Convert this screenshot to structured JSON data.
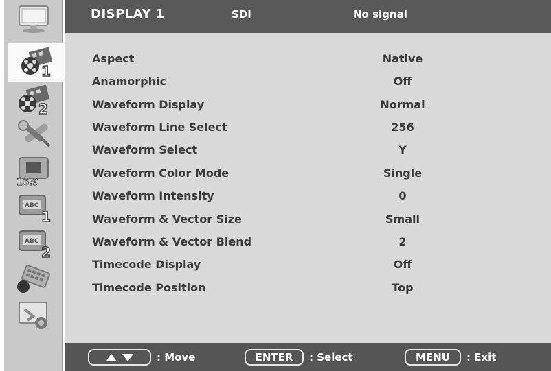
{
  "header": {
    "title": "DISPLAY 1",
    "input": "SDI",
    "status": "No signal"
  },
  "sidebar": {
    "items": [
      {
        "icon": "monitor-icon",
        "badge": ""
      },
      {
        "icon": "film-reel-icon",
        "badge": "1",
        "selected": true
      },
      {
        "icon": "film-reel-icon",
        "badge": "2"
      },
      {
        "icon": "tools-icon",
        "badge": ""
      },
      {
        "icon": "aspect-ratio-icon",
        "badge": "16:9"
      },
      {
        "icon": "caption-icon",
        "badge": "1"
      },
      {
        "icon": "caption-icon",
        "badge": "2"
      },
      {
        "icon": "keyboard-icon",
        "badge": ""
      },
      {
        "icon": "system-icon",
        "badge": ""
      }
    ]
  },
  "menu": {
    "items": [
      {
        "label": "Aspect",
        "value": "Native"
      },
      {
        "label": "Anamorphic",
        "value": "Off"
      },
      {
        "label": "Waveform Display",
        "value": "Normal"
      },
      {
        "label": "Waveform Line Select",
        "value": "256"
      },
      {
        "label": "Waveform Select",
        "value": "Y"
      },
      {
        "label": "Waveform Color Mode",
        "value": "Single"
      },
      {
        "label": "Waveform Intensity",
        "value": "0"
      },
      {
        "label": "Waveform & Vector Size",
        "value": "Small"
      },
      {
        "label": "Waveform & Vector Blend",
        "value": "2"
      },
      {
        "label": "Timecode Display",
        "value": "Off"
      },
      {
        "label": "Timecode Position",
        "value": "Top"
      }
    ]
  },
  "footer": {
    "move_hint": ": Move",
    "enter_key": "ENTER",
    "select_hint": ": Select",
    "menu_key": "MENU",
    "exit_hint": ": Exit"
  }
}
